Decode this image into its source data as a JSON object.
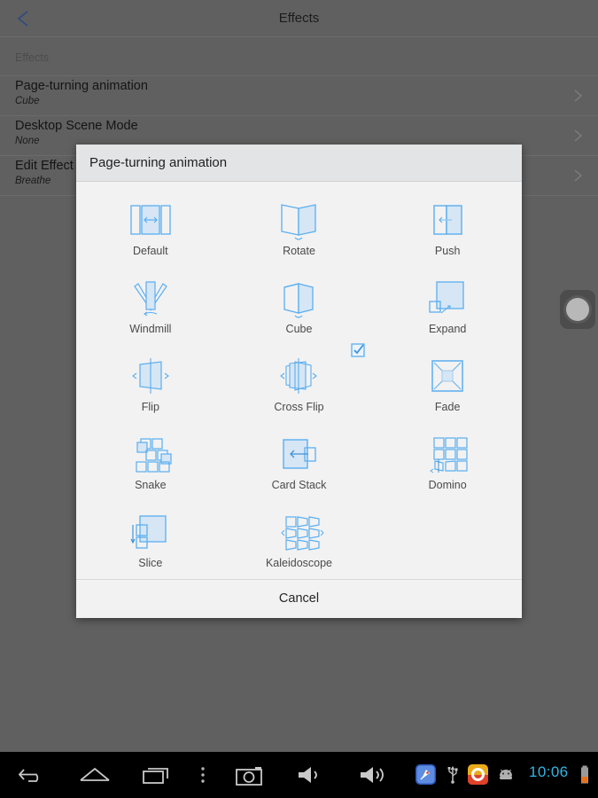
{
  "header": {
    "title": "Effects",
    "back_icon": "chevron-left-icon"
  },
  "settings_list": {
    "section_label": "Effects",
    "rows": [
      {
        "title": "Page-turning animation",
        "value": "Cube",
        "chevron": "chevron-right-icon"
      },
      {
        "title": "Desktop Scene Mode",
        "value": "None",
        "chevron": "chevron-right-icon"
      },
      {
        "title": "Edit Effect",
        "value": "Breathe",
        "chevron": "chevron-right-icon"
      }
    ]
  },
  "dialog": {
    "title": "Page-turning animation",
    "cancel_label": "Cancel",
    "selected_option": "Cube",
    "selected_indicator_icon": "checkbox-checked-icon",
    "options": [
      {
        "label": "Default",
        "icon": "default-animation-icon"
      },
      {
        "label": "Rotate",
        "icon": "rotate-animation-icon"
      },
      {
        "label": "Push",
        "icon": "push-animation-icon"
      },
      {
        "label": "Windmill",
        "icon": "windmill-animation-icon"
      },
      {
        "label": "Cube",
        "icon": "cube-animation-icon"
      },
      {
        "label": "Expand",
        "icon": "expand-animation-icon"
      },
      {
        "label": "Flip",
        "icon": "flip-animation-icon"
      },
      {
        "label": "Cross Flip",
        "icon": "cross-flip-animation-icon"
      },
      {
        "label": "Fade",
        "icon": "fade-animation-icon"
      },
      {
        "label": "Snake",
        "icon": "snake-animation-icon"
      },
      {
        "label": "Card Stack",
        "icon": "card-stack-animation-icon"
      },
      {
        "label": "Domino",
        "icon": "domino-animation-icon"
      },
      {
        "label": "Slice",
        "icon": "slice-animation-icon"
      },
      {
        "label": "Kaleidoscope",
        "icon": "kaleidoscope-animation-icon"
      }
    ]
  },
  "floating_widget": {
    "icon": "circle-widget-icon"
  },
  "navbar": {
    "buttons": [
      {
        "icon": "back-icon"
      },
      {
        "icon": "home-icon"
      },
      {
        "icon": "recent-apps-icon"
      },
      {
        "icon": "menu-overflow-icon"
      },
      {
        "icon": "screenshot-camera-icon"
      },
      {
        "icon": "volume-down-icon"
      },
      {
        "icon": "volume-up-icon"
      }
    ],
    "status_icons": [
      {
        "icon": "rocket-app-icon"
      },
      {
        "icon": "usb-icon"
      },
      {
        "icon": "orange-ring-app-icon"
      },
      {
        "icon": "android-robot-icon"
      }
    ],
    "time": "10:06",
    "battery_icon": "battery-icon"
  },
  "colors": {
    "accent_blue": "#5aaef0",
    "icon_fill": "#d6e6f5",
    "dialog_bg": "#f2f2f2",
    "dialog_header_bg": "#e2e4e6",
    "background_gray": "#606060",
    "time_blue": "#33b5e5"
  }
}
